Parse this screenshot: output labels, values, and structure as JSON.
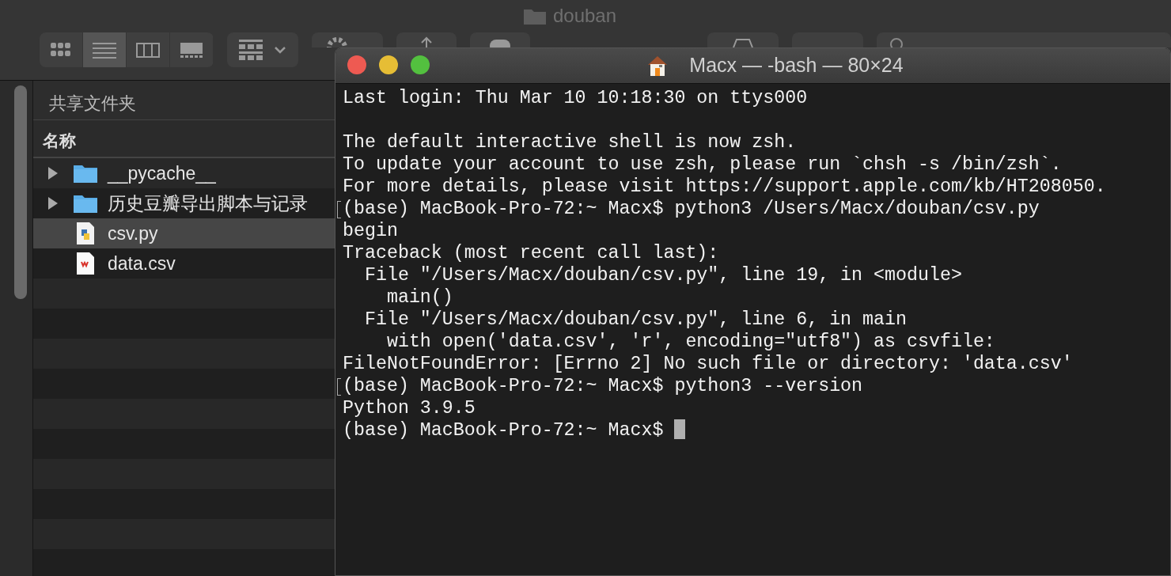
{
  "finder": {
    "title": "douban",
    "view_modes": [
      {
        "kind": "icons",
        "selected": false
      },
      {
        "kind": "list",
        "selected": true
      },
      {
        "kind": "columns",
        "selected": false
      },
      {
        "kind": "gallery",
        "selected": false
      }
    ],
    "sidebar_heading": "共享文件夹",
    "column_header": "名称",
    "files": [
      {
        "name": "__pycache__",
        "kind": "folder",
        "expanded": false,
        "selected": false
      },
      {
        "name": "历史豆瓣导出脚本与记录",
        "kind": "folder",
        "expanded": false,
        "selected": false
      },
      {
        "name": "csv.py",
        "kind": "python",
        "selected": true
      },
      {
        "name": "data.csv",
        "kind": "spreadsheet",
        "selected": false
      }
    ]
  },
  "terminal": {
    "title": "Macx — -bash — 80×24",
    "cursor": true,
    "lines": [
      {
        "text": "Last login: Thu Mar 10 10:18:30 on ttys000",
        "marked": false
      },
      {
        "marked": false
      },
      {
        "text": "The default interactive shell is now zsh.",
        "marked": false
      },
      {
        "text": "To update your account to use zsh, please run `chsh -s /bin/zsh`.",
        "marked": false
      },
      {
        "text": "For more details, please visit https://support.apple.com/kb/HT208050.",
        "marked": false
      },
      {
        "text": "(base) MacBook-Pro-72:~ Macx$ python3 /Users/Macx/douban/csv.py",
        "marked": true
      },
      {
        "text": "begin",
        "marked": false
      },
      {
        "text": "Traceback (most recent call last):",
        "marked": false
      },
      {
        "text": "  File \"/Users/Macx/douban/csv.py\", line 19, in <module>",
        "marked": false
      },
      {
        "text": "    main()",
        "marked": false
      },
      {
        "text": "  File \"/Users/Macx/douban/csv.py\", line 6, in main",
        "marked": false
      },
      {
        "text": "    with open('data.csv', 'r', encoding=\"utf8\") as csvfile:",
        "marked": false
      },
      {
        "text": "FileNotFoundError: [Errno 2] No such file or directory: 'data.csv'",
        "marked": false
      },
      {
        "text": "(base) MacBook-Pro-72:~ Macx$ python3 --version",
        "marked": true
      },
      {
        "text": "Python 3.9.5",
        "marked": false
      },
      {
        "text": "(base) MacBook-Pro-72:~ Macx$ ",
        "marked": false
      }
    ]
  }
}
